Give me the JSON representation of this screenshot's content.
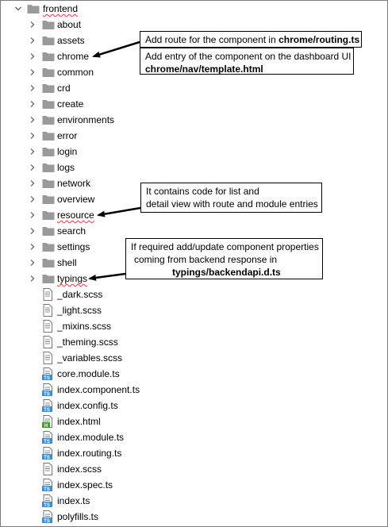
{
  "tree": {
    "root": "frontend",
    "folders": [
      "about",
      "assets",
      "chrome",
      "common",
      "crd",
      "create",
      "environments",
      "error",
      "login",
      "logs",
      "network",
      "overview",
      "resource",
      "search",
      "settings",
      "shell",
      "typings"
    ],
    "files": [
      {
        "name": "_dark.scss",
        "icon": "scss-file-icon"
      },
      {
        "name": "_light.scss",
        "icon": "scss-file-icon"
      },
      {
        "name": "_mixins.scss",
        "icon": "scss-file-icon"
      },
      {
        "name": "_theming.scss",
        "icon": "scss-file-icon"
      },
      {
        "name": "_variables.scss",
        "icon": "scss-file-icon"
      },
      {
        "name": "core.module.ts",
        "icon": "ts-file-icon"
      },
      {
        "name": "index.component.ts",
        "icon": "ts-file-icon"
      },
      {
        "name": "index.config.ts",
        "icon": "ts-file-icon"
      },
      {
        "name": "index.html",
        "icon": "html-file-icon"
      },
      {
        "name": "index.module.ts",
        "icon": "ts-file-icon"
      },
      {
        "name": "index.routing.ts",
        "icon": "ts-file-icon"
      },
      {
        "name": "index.scss",
        "icon": "scss-file-icon"
      },
      {
        "name": "index.spec.ts",
        "icon": "ts-file-icon"
      },
      {
        "name": "index.ts",
        "icon": "ts-file-icon"
      },
      {
        "name": "polyfills.ts",
        "icon": "ts-file-icon"
      }
    ]
  },
  "callouts": {
    "routing": {
      "text": "Add route for the component in ",
      "bold": "chrome/routing.ts"
    },
    "nav": {
      "line1": "Add entry of the component on the dashboard UI",
      "bold": "chrome/nav/template.html"
    },
    "resource": {
      "line1": "It contains code for list and",
      "line2": "detail view with route and module entries"
    },
    "typings": {
      "line1": "If required add/update component properties",
      "line2": "coming from backend response in",
      "bold": "typings/backendapi.d.ts"
    }
  },
  "colors": {
    "folder": "#9a9a9a",
    "ts_badge": "#3e8ed0",
    "html_badge": "#4a9a3a",
    "squiggle": "#e23b3b"
  }
}
